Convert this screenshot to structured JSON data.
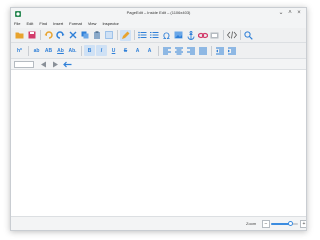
{
  "window": {
    "title": "PageEdit – Inside Edit – (1106x403)",
    "minimize": "⌄",
    "maximize": "˄",
    "close": "×"
  },
  "menubar": {
    "items": [
      "File",
      "Edit",
      "Find",
      "Insert",
      "Format",
      "View",
      "Inspector"
    ]
  },
  "toolbar2": {
    "heading_label": "h*",
    "text_ab": "ab",
    "text_AB": "AB",
    "text_Ab": "Ab",
    "text_Ab2": "Ab.",
    "bold": "B",
    "italic": "I",
    "underline": "U",
    "strike": "S",
    "subscript": "A",
    "superscript": "A"
  },
  "statusbar": {
    "zoom_label": "Zoom",
    "zoom_minus": "−",
    "zoom_plus": "+",
    "zoom_level": 0.72
  },
  "colors": {
    "accent": "#2e7fd8",
    "folder": "#e8a32e",
    "save": "#d23b6a",
    "undo": "#e8a32e",
    "cut": "#2e7fd8",
    "pen": "#e8a32e"
  }
}
